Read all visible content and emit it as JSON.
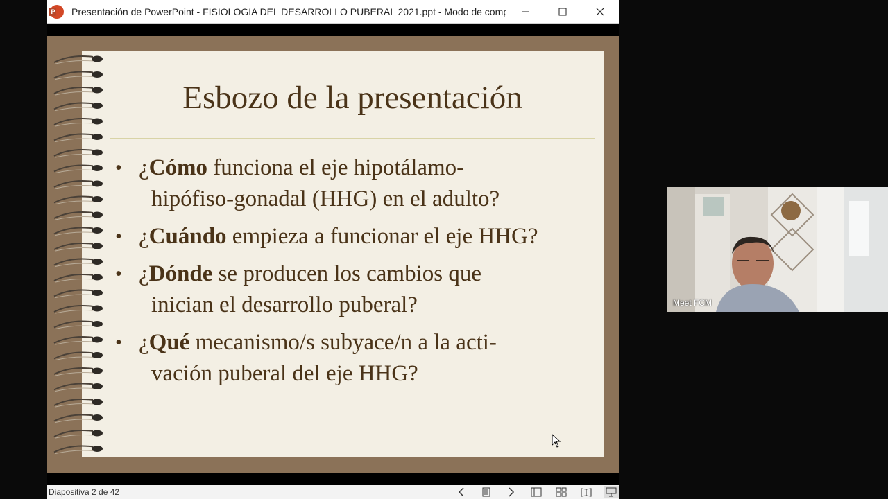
{
  "window": {
    "title": "Presentación de PowerPoint  -  FISIOLOGIA DEL DESARROLLO PUBERAL 2021.ppt  -  Modo de comp...",
    "app_icon_letter": "P"
  },
  "slide": {
    "title": "Esbozo de la presentación",
    "bullets": [
      {
        "bold": "Cómo",
        "line1_rest": " funciona el eje hipotálamo-",
        "line2": "hipófiso-gonadal (HHG) en el adulto?"
      },
      {
        "bold": "Cuándo",
        "line1_rest": " empieza a funcionar el eje HHG?",
        "line2": ""
      },
      {
        "bold": "Dónde",
        "line1_rest": " se producen los cambios que",
        "line2": "inician el desarrollo puberal?"
      },
      {
        "bold": "Qué",
        "line1_rest": " mecanismo/s subyace/n a la acti-",
        "line2": "vación puberal del eje HHG?"
      }
    ],
    "bullet_prefix": "¿"
  },
  "statusbar": {
    "slide_counter": "Diapositiva 2 de 42"
  },
  "video": {
    "participant_name": "Meet FCM"
  },
  "colors": {
    "slide_frame": "#8b7258",
    "slide_paper": "#f3efe4",
    "slide_text": "#4a3318"
  }
}
